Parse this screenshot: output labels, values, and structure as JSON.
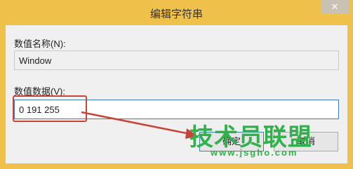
{
  "window": {
    "title": "编辑字符串",
    "close_glyph": "✕"
  },
  "value_name": {
    "label": "数值名称(N):",
    "value": "Window"
  },
  "value_data": {
    "label": "数值数据(V):",
    "value": "0 191 255"
  },
  "buttons": {
    "ok_label": "确定",
    "cancel_label": "取消"
  },
  "watermark": {
    "text": "技术员联盟",
    "url": "www.jsgho.com"
  },
  "colors": {
    "title_bar": "#f0c14a",
    "annotation_red": "#c8443a",
    "watermark_green": "#2fb24b"
  }
}
